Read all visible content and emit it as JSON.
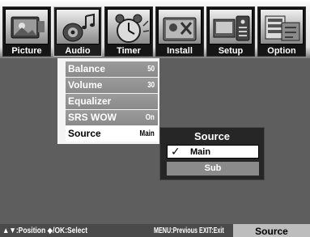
{
  "tabs": [
    {
      "label": "Picture",
      "icon": "picture-icon"
    },
    {
      "label": "Audio",
      "icon": "audio-icon",
      "active": true
    },
    {
      "label": "Timer",
      "icon": "timer-icon"
    },
    {
      "label": "Install",
      "icon": "install-icon"
    },
    {
      "label": "Setup",
      "icon": "setup-icon"
    },
    {
      "label": "Option",
      "icon": "option-icon"
    }
  ],
  "audio_menu": {
    "items": [
      {
        "label": "Balance",
        "value": "50"
      },
      {
        "label": "Volume",
        "value": "30"
      },
      {
        "label": "Equalizer",
        "value": ""
      },
      {
        "label": "SRS WOW",
        "value": "On"
      },
      {
        "label": "Source",
        "value": "Main",
        "selected": true
      }
    ]
  },
  "source_popup": {
    "title": "Source",
    "options": [
      {
        "label": "Main",
        "checked": true,
        "check_mark": "✓"
      },
      {
        "label": "Sub",
        "checked": false
      }
    ]
  },
  "help_bar": {
    "navigation": "▲▼:Position  ◆/OK:Select",
    "menu_exit": "MENU:Previous  EXIT:Exit",
    "current_page": "Source"
  },
  "colors": {
    "background": "#5e5e5e",
    "menu_item": "#8a8a8a",
    "menu_item_selected": "#ffffff",
    "popup": "#262626",
    "bottom_bar": "#4a4a4a"
  }
}
